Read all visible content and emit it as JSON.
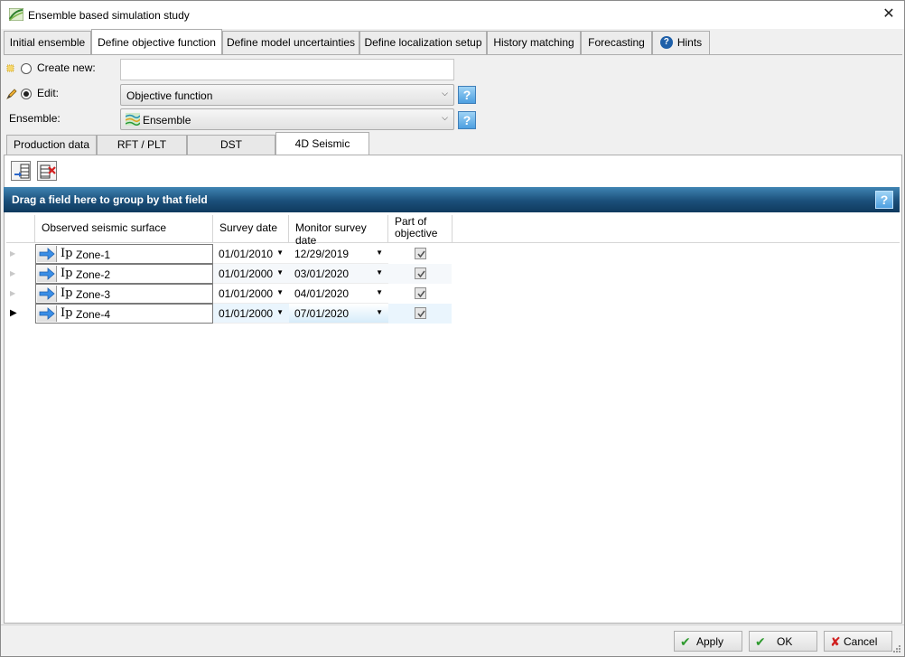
{
  "window": {
    "title": "Ensemble based simulation study",
    "close_label": "✕"
  },
  "tabs": [
    {
      "label": "Initial ensemble"
    },
    {
      "label": "Define objective function"
    },
    {
      "label": "Define model uncertainties"
    },
    {
      "label": "Define localization setup"
    },
    {
      "label": "History matching"
    },
    {
      "label": "Forecasting"
    },
    {
      "label": "Hints"
    }
  ],
  "form": {
    "create_new_label": "Create new:",
    "create_new_value": "",
    "edit_label": "Edit:",
    "edit_value": "Objective function",
    "ensemble_label": "Ensemble:",
    "ensemble_value": "Ensemble",
    "help_label": "?"
  },
  "subtabs": [
    {
      "label": "Production data"
    },
    {
      "label": "RFT / PLT"
    },
    {
      "label": "DST"
    },
    {
      "label": "4D Seismic"
    }
  ],
  "group_bar": {
    "text": "Drag a field here to group by that field",
    "help": "?"
  },
  "grid": {
    "headers": {
      "surface": "Observed seismic surface",
      "survey": "Survey date",
      "monitor": "Monitor survey date",
      "part": "Part of objective"
    },
    "ip_symbol": "Ip",
    "rows": [
      {
        "surface": "Zone-1",
        "survey": "01/01/2010",
        "monitor": "12/29/2019",
        "part": true
      },
      {
        "surface": "Zone-2",
        "survey": "01/01/2000",
        "monitor": "03/01/2020",
        "part": true
      },
      {
        "surface": "Zone-3",
        "survey": "01/01/2000",
        "monitor": "04/01/2020",
        "part": true
      },
      {
        "surface": "Zone-4",
        "survey": "01/01/2000",
        "monitor": "07/01/2020",
        "part": true
      }
    ]
  },
  "buttons": {
    "apply": "Apply",
    "ok": "OK",
    "cancel": "Cancel"
  },
  "colors": {
    "group_bar": "#1b4f7a",
    "hint_icon": "#1e5fa8",
    "apply_check": "#2e9a2e",
    "cancel_x": "#d02020"
  }
}
